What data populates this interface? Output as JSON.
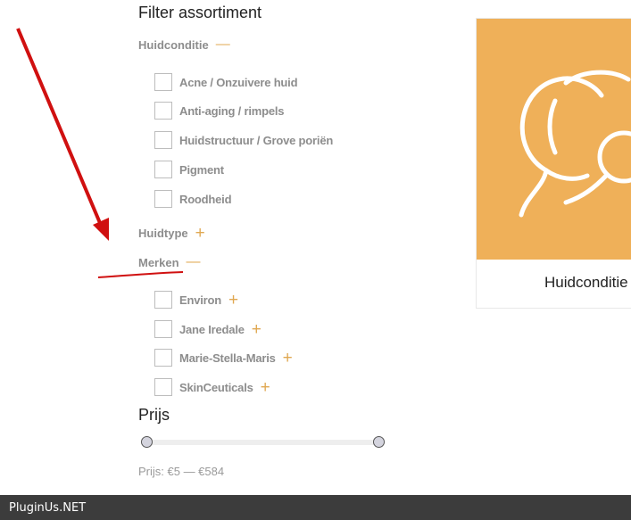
{
  "filter": {
    "title": "Filter assortiment",
    "groups": [
      {
        "label": "Huidconditie",
        "toggle": "—",
        "options": [
          {
            "label": "Acne / Onzuivere huid"
          },
          {
            "label": "Anti-aging / rimpels"
          },
          {
            "label": "Huidstructuur / Grove poriën"
          },
          {
            "label": "Pigment"
          },
          {
            "label": "Roodheid"
          }
        ]
      },
      {
        "label": "Huidtype",
        "toggle": "+"
      },
      {
        "label": "Merken",
        "toggle": "—",
        "options": [
          {
            "label": "Environ",
            "toggle": "+"
          },
          {
            "label": "Jane Iredale",
            "toggle": "+"
          },
          {
            "label": "Marie-Stella-Maris",
            "toggle": "+"
          },
          {
            "label": "SkinCeuticals",
            "toggle": "+"
          }
        ]
      }
    ]
  },
  "price": {
    "title": "Prijs",
    "label": "Prijs: €5 — €584"
  },
  "card": {
    "caption": "Huidconditie",
    "icon": "face-icon",
    "bg_color": "#efb059"
  },
  "footer": {
    "text": "PluginUs.NET"
  },
  "colors": {
    "accent": "#e0a852",
    "annotation": "#d01010",
    "footer_bg": "#3c3c3c"
  }
}
